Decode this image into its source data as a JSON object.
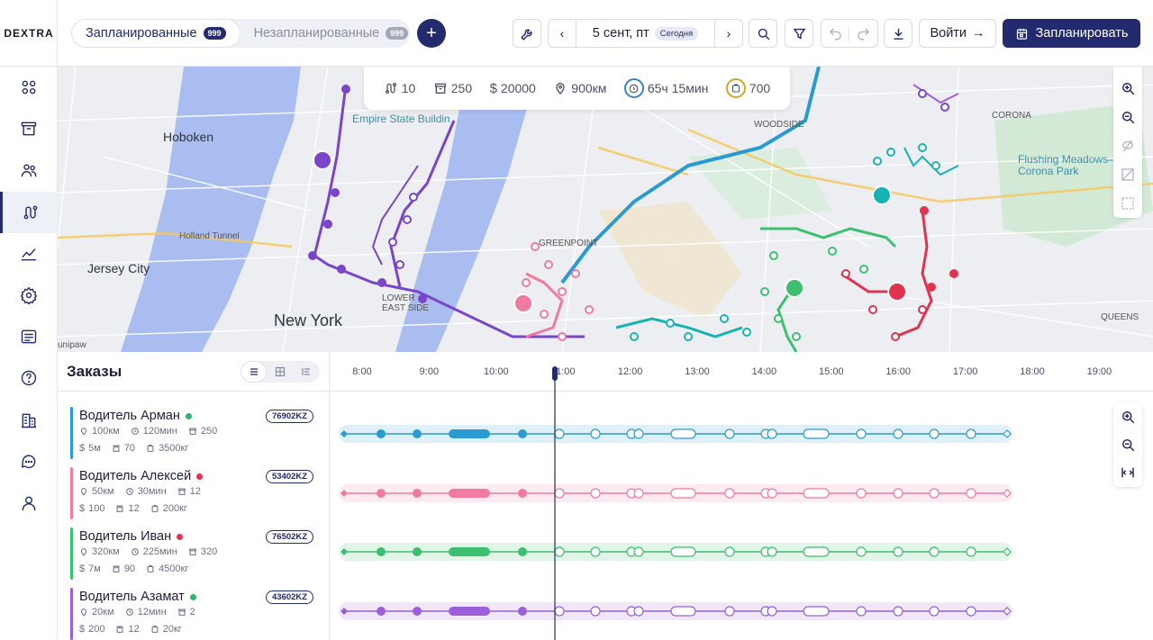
{
  "app": {
    "logo": "DEXTRA"
  },
  "nav": [
    {
      "name": "dashboard-icon"
    },
    {
      "name": "archive-icon"
    },
    {
      "name": "users-icon"
    },
    {
      "name": "routes-icon",
      "active": true
    },
    {
      "name": "analytics-icon"
    },
    {
      "name": "settings-icon"
    },
    {
      "name": "list-icon"
    },
    {
      "name": "help-icon"
    },
    {
      "name": "buildings-icon"
    },
    {
      "name": "chat-icon"
    },
    {
      "name": "profile-icon"
    }
  ],
  "header": {
    "tabs": [
      {
        "label": "Запланированные",
        "count": "999",
        "active": true
      },
      {
        "label": "Незапланированные",
        "count": "999",
        "active": false
      }
    ],
    "date": "5 сент, пт",
    "today": "Сегодня",
    "login": "Войти",
    "plan": "Запланировать"
  },
  "stats": {
    "routes": "10",
    "orders": "250",
    "cost": "20000",
    "distance": "900км",
    "time": "65ч 15мин",
    "weight": "700"
  },
  "map_labels": {
    "hoboken": "Hoboken",
    "jersey_city": "Jersey City",
    "new_york": "New York",
    "esb": "Empire State Buildin",
    "flushing": "Flushing Meadows–Corona Park",
    "greenpoint": "GREENPOINT",
    "lower_east": "LOWER EAST SIDE",
    "holland": "Holland Tunnel",
    "woodside": "WOODSIDE",
    "corona": "CORONA",
    "queens": "QUEENS",
    "unipaw": "unipaw"
  },
  "orders": {
    "title": "Заказы",
    "drivers": [
      {
        "name": "Водитель Арман",
        "status_color": "#2bb673",
        "plate": "76902KZ",
        "color": "#2a9bd0",
        "km": "100км",
        "time": "120мин",
        "orders": "250",
        "cost": "5м",
        "boxes": "70",
        "weight": "3500кг"
      },
      {
        "name": "Водитель Алексей",
        "status_color": "#e0334f",
        "plate": "53402KZ",
        "color": "#f07aa0",
        "km": "50км",
        "time": "30мин",
        "orders": "12",
        "cost": "100",
        "boxes": "12",
        "weight": "200кг"
      },
      {
        "name": "Водитель Иван",
        "status_color": "#e0334f",
        "plate": "76502KZ",
        "color": "#3cbf6e",
        "km": "320км",
        "time": "225мин",
        "orders": "320",
        "cost": "7м",
        "boxes": "90",
        "weight": "4500кг"
      },
      {
        "name": "Водитель Азамат",
        "status_color": "#2bb673",
        "plate": "43602KZ",
        "color": "#9b5fd9",
        "km": "20км",
        "time": "12мин",
        "orders": "2",
        "cost": "200",
        "boxes": "12",
        "weight": "20кг"
      }
    ]
  },
  "timeline": {
    "hours": [
      "8:00",
      "9:00",
      "10:00",
      "11:00",
      "12:00",
      "13:00",
      "14:00",
      "15:00",
      "16:00",
      "17:00",
      "18:00",
      "19:00"
    ],
    "current_time": "11:00"
  },
  "colors": {
    "accent": "#232a6e"
  }
}
